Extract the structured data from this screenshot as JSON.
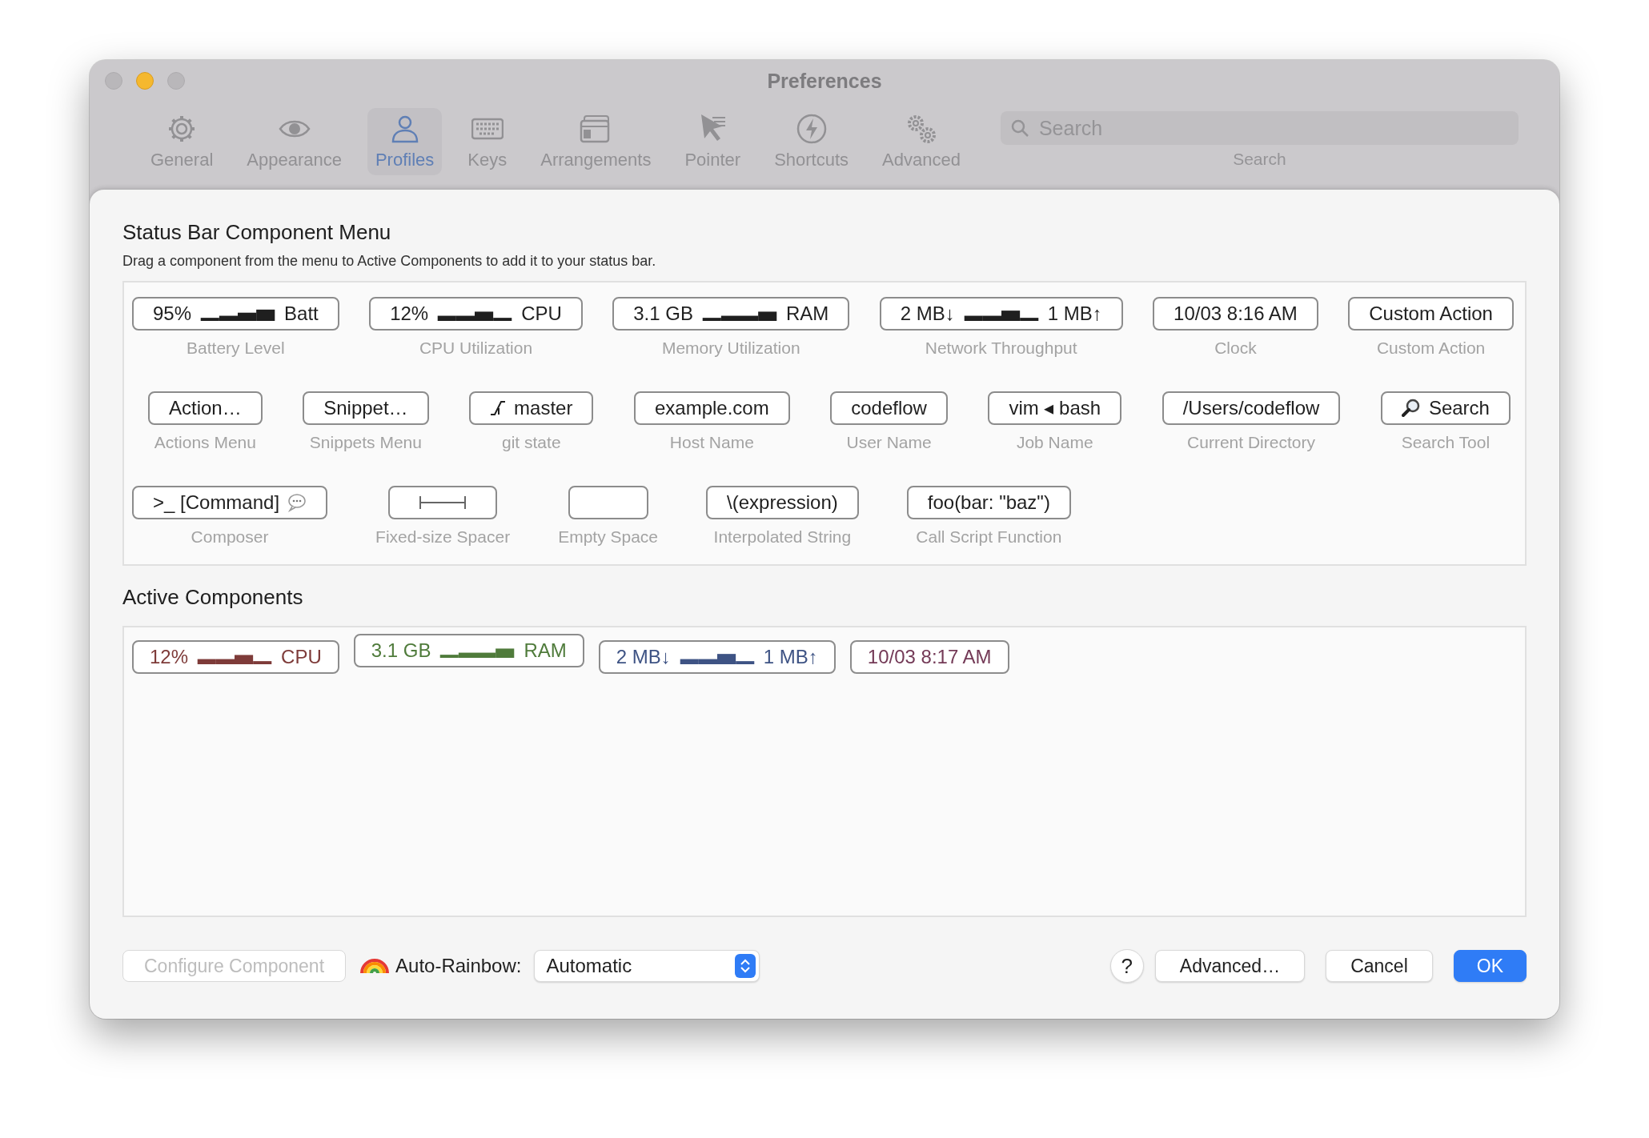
{
  "window": {
    "title": "Preferences"
  },
  "toolbar": {
    "items": [
      {
        "label": "General",
        "selected": false
      },
      {
        "label": "Appearance",
        "selected": false
      },
      {
        "label": "Profiles",
        "selected": true
      },
      {
        "label": "Keys",
        "selected": false
      },
      {
        "label": "Arrangements",
        "selected": false
      },
      {
        "label": "Pointer",
        "selected": false
      },
      {
        "label": "Shortcuts",
        "selected": false
      },
      {
        "label": "Advanced",
        "selected": false
      }
    ],
    "search": {
      "placeholder": "Search",
      "label": "Search"
    }
  },
  "component_menu": {
    "title": "Status Bar Component Menu",
    "description": "Drag a component from the menu to Active Components to add it to your status bar.",
    "components": [
      {
        "kind": "sparkline",
        "prefix": "95%",
        "suffix": "Batt",
        "label": "Battery Level"
      },
      {
        "kind": "sparkline",
        "prefix": "12%",
        "suffix": "CPU",
        "label": "CPU Utilization"
      },
      {
        "kind": "sparkline",
        "prefix": "3.1 GB",
        "suffix": "RAM",
        "label": "Memory Utilization"
      },
      {
        "kind": "sparkline",
        "prefix": "2 MB↓",
        "suffix": "1 MB↑",
        "label": "Network Throughput"
      },
      {
        "kind": "text",
        "text": "10/03 8:16 AM",
        "label": "Clock"
      },
      {
        "kind": "text",
        "text": "Custom Action",
        "label": "Custom Action"
      },
      {
        "kind": "text",
        "text": "Action…",
        "label": "Actions Menu"
      },
      {
        "kind": "text",
        "text": "Snippet…",
        "label": "Snippets Menu"
      },
      {
        "kind": "git",
        "text": "master",
        "label": "git state"
      },
      {
        "kind": "text",
        "text": "example.com",
        "label": "Host Name"
      },
      {
        "kind": "text",
        "text": "codeflow",
        "label": "User Name"
      },
      {
        "kind": "text",
        "text": "vim ◂ bash",
        "label": "Job Name"
      },
      {
        "kind": "text",
        "text": "/Users/codeflow",
        "label": "Current Directory"
      },
      {
        "kind": "search",
        "text": "Search",
        "label": "Search Tool"
      },
      {
        "kind": "composer",
        "text": ">_ [Command]",
        "label": "Composer"
      },
      {
        "kind": "spacer",
        "label": "Fixed-size Spacer"
      },
      {
        "kind": "empty",
        "label": "Empty Space"
      },
      {
        "kind": "text",
        "text": "\\(expression)",
        "label": "Interpolated String"
      },
      {
        "kind": "text",
        "text": "foo(bar: \"baz\")",
        "label": "Call Script Function"
      }
    ]
  },
  "active_components": {
    "title": "Active Components",
    "items": [
      {
        "kind": "sparkline",
        "prefix": "12%",
        "suffix": "CPU",
        "color": "#7e3b39"
      },
      {
        "kind": "sparkline",
        "prefix": "3.1 GB",
        "suffix": "RAM",
        "color": "#4f7b3b"
      },
      {
        "kind": "sparkline",
        "prefix": "2 MB↓",
        "suffix": "1 MB↑",
        "color": "#3e5384"
      },
      {
        "kind": "text",
        "text": "10/03 8:17 AM",
        "color": "#743a57"
      }
    ]
  },
  "footer": {
    "configure_button": {
      "label": "Configure Component",
      "disabled": true
    },
    "auto_rainbow": {
      "label": "Auto-Rainbow:",
      "value": "Automatic"
    },
    "help_button": "?",
    "buttons": [
      {
        "label": "Advanced…",
        "default": false
      },
      {
        "label": "Cancel",
        "default": false
      },
      {
        "label": "OK",
        "default": true
      }
    ]
  }
}
